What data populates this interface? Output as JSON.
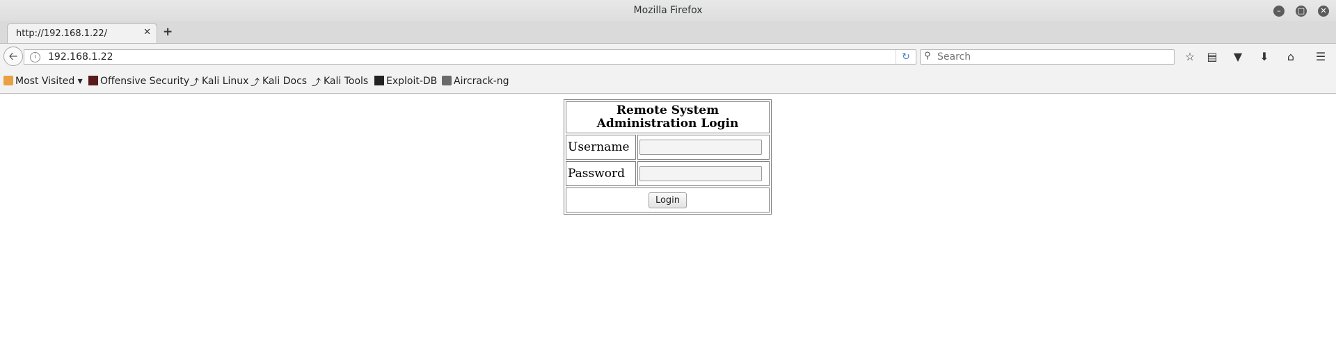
{
  "window": {
    "title": "Mozilla Firefox"
  },
  "tabs": [
    {
      "label": "http://192.168.1.22/"
    }
  ],
  "navbar": {
    "url": "192.168.1.22",
    "search_placeholder": "Search"
  },
  "bookmarks": [
    {
      "label": "Most Visited ▾",
      "icon": "folder-icon"
    },
    {
      "label": "Offensive Security",
      "icon": "offsec-icon"
    },
    {
      "label": "Kali Linux",
      "icon": "kali-dragon-icon"
    },
    {
      "label": "Kali Docs",
      "icon": "kali-dragon-icon"
    },
    {
      "label": "Kali Tools",
      "icon": "kali-dragon-icon"
    },
    {
      "label": "Exploit-DB",
      "icon": "exploit-db-icon"
    },
    {
      "label": "Aircrack-ng",
      "icon": "aircrack-icon"
    }
  ],
  "login_form": {
    "title": "Remote System Administration Login",
    "username_label": "Username",
    "password_label": "Password",
    "username_value": "",
    "password_value": "",
    "login_button": "Login"
  }
}
